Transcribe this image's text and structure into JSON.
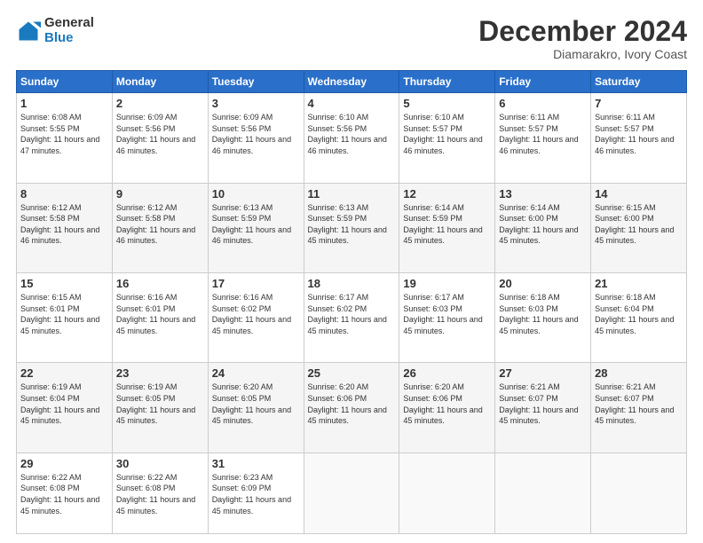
{
  "logo": {
    "general": "General",
    "blue": "Blue"
  },
  "header": {
    "month": "December 2024",
    "location": "Diamarakro, Ivory Coast"
  },
  "weekdays": [
    "Sunday",
    "Monday",
    "Tuesday",
    "Wednesday",
    "Thursday",
    "Friday",
    "Saturday"
  ],
  "weeks": [
    [
      {
        "day": "1",
        "sunrise": "6:08 AM",
        "sunset": "5:55 PM",
        "daylight": "11 hours and 47 minutes."
      },
      {
        "day": "2",
        "sunrise": "6:09 AM",
        "sunset": "5:56 PM",
        "daylight": "11 hours and 46 minutes."
      },
      {
        "day": "3",
        "sunrise": "6:09 AM",
        "sunset": "5:56 PM",
        "daylight": "11 hours and 46 minutes."
      },
      {
        "day": "4",
        "sunrise": "6:10 AM",
        "sunset": "5:56 PM",
        "daylight": "11 hours and 46 minutes."
      },
      {
        "day": "5",
        "sunrise": "6:10 AM",
        "sunset": "5:57 PM",
        "daylight": "11 hours and 46 minutes."
      },
      {
        "day": "6",
        "sunrise": "6:11 AM",
        "sunset": "5:57 PM",
        "daylight": "11 hours and 46 minutes."
      },
      {
        "day": "7",
        "sunrise": "6:11 AM",
        "sunset": "5:57 PM",
        "daylight": "11 hours and 46 minutes."
      }
    ],
    [
      {
        "day": "8",
        "sunrise": "6:12 AM",
        "sunset": "5:58 PM",
        "daylight": "11 hours and 46 minutes."
      },
      {
        "day": "9",
        "sunrise": "6:12 AM",
        "sunset": "5:58 PM",
        "daylight": "11 hours and 46 minutes."
      },
      {
        "day": "10",
        "sunrise": "6:13 AM",
        "sunset": "5:59 PM",
        "daylight": "11 hours and 46 minutes."
      },
      {
        "day": "11",
        "sunrise": "6:13 AM",
        "sunset": "5:59 PM",
        "daylight": "11 hours and 45 minutes."
      },
      {
        "day": "12",
        "sunrise": "6:14 AM",
        "sunset": "5:59 PM",
        "daylight": "11 hours and 45 minutes."
      },
      {
        "day": "13",
        "sunrise": "6:14 AM",
        "sunset": "6:00 PM",
        "daylight": "11 hours and 45 minutes."
      },
      {
        "day": "14",
        "sunrise": "6:15 AM",
        "sunset": "6:00 PM",
        "daylight": "11 hours and 45 minutes."
      }
    ],
    [
      {
        "day": "15",
        "sunrise": "6:15 AM",
        "sunset": "6:01 PM",
        "daylight": "11 hours and 45 minutes."
      },
      {
        "day": "16",
        "sunrise": "6:16 AM",
        "sunset": "6:01 PM",
        "daylight": "11 hours and 45 minutes."
      },
      {
        "day": "17",
        "sunrise": "6:16 AM",
        "sunset": "6:02 PM",
        "daylight": "11 hours and 45 minutes."
      },
      {
        "day": "18",
        "sunrise": "6:17 AM",
        "sunset": "6:02 PM",
        "daylight": "11 hours and 45 minutes."
      },
      {
        "day": "19",
        "sunrise": "6:17 AM",
        "sunset": "6:03 PM",
        "daylight": "11 hours and 45 minutes."
      },
      {
        "day": "20",
        "sunrise": "6:18 AM",
        "sunset": "6:03 PM",
        "daylight": "11 hours and 45 minutes."
      },
      {
        "day": "21",
        "sunrise": "6:18 AM",
        "sunset": "6:04 PM",
        "daylight": "11 hours and 45 minutes."
      }
    ],
    [
      {
        "day": "22",
        "sunrise": "6:19 AM",
        "sunset": "6:04 PM",
        "daylight": "11 hours and 45 minutes."
      },
      {
        "day": "23",
        "sunrise": "6:19 AM",
        "sunset": "6:05 PM",
        "daylight": "11 hours and 45 minutes."
      },
      {
        "day": "24",
        "sunrise": "6:20 AM",
        "sunset": "6:05 PM",
        "daylight": "11 hours and 45 minutes."
      },
      {
        "day": "25",
        "sunrise": "6:20 AM",
        "sunset": "6:06 PM",
        "daylight": "11 hours and 45 minutes."
      },
      {
        "day": "26",
        "sunrise": "6:20 AM",
        "sunset": "6:06 PM",
        "daylight": "11 hours and 45 minutes."
      },
      {
        "day": "27",
        "sunrise": "6:21 AM",
        "sunset": "6:07 PM",
        "daylight": "11 hours and 45 minutes."
      },
      {
        "day": "28",
        "sunrise": "6:21 AM",
        "sunset": "6:07 PM",
        "daylight": "11 hours and 45 minutes."
      }
    ],
    [
      {
        "day": "29",
        "sunrise": "6:22 AM",
        "sunset": "6:08 PM",
        "daylight": "11 hours and 45 minutes."
      },
      {
        "day": "30",
        "sunrise": "6:22 AM",
        "sunset": "6:08 PM",
        "daylight": "11 hours and 45 minutes."
      },
      {
        "day": "31",
        "sunrise": "6:23 AM",
        "sunset": "6:09 PM",
        "daylight": "11 hours and 45 minutes."
      },
      null,
      null,
      null,
      null
    ]
  ]
}
